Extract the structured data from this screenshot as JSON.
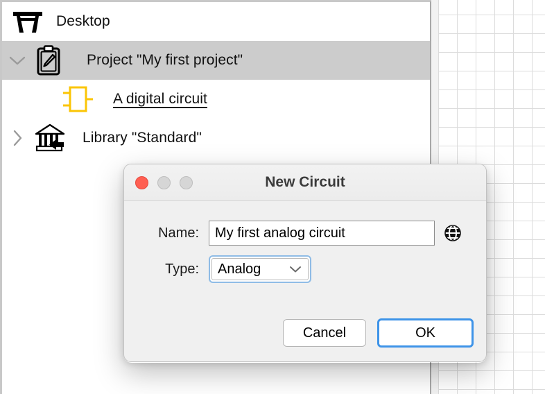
{
  "canvas": {
    "name": "circuit-canvas",
    "grid_color": "#dcdcdc",
    "background": "#ffffff"
  },
  "tree": {
    "selection_color": "#cccccc",
    "rows": [
      {
        "id": "desktop",
        "label": "Desktop",
        "icon": "desk-icon",
        "twisty": "none",
        "selected": false,
        "underlined": false
      },
      {
        "id": "project",
        "label": "Project \"My first project\"",
        "icon": "clipboard-pencil-icon",
        "twisty": "chevron-down-icon",
        "selected": true,
        "underlined": false
      },
      {
        "id": "circuit",
        "label": "A digital circuit",
        "icon": "digital-circuit-icon",
        "twisty": "none",
        "selected": false,
        "underlined": true,
        "icon_color": "#fbc505"
      },
      {
        "id": "library",
        "label": "Library \"Standard\"",
        "icon": "library-import-icon",
        "twisty": "chevron-right-icon",
        "selected": false,
        "underlined": false
      }
    ]
  },
  "dialog": {
    "title": "New Circuit",
    "window_controls": {
      "close": "close-button",
      "minimize": "minimize-button",
      "zoom": "zoom-button",
      "close_color": "#ff5f52",
      "inactive_color": "#d6d6d6"
    },
    "fields": {
      "name": {
        "label": "Name:",
        "value": "My first analog circuit",
        "placeholder": "",
        "trailing_icon": "globe-icon"
      },
      "type": {
        "label": "Type:",
        "value": "Analog",
        "options": [
          "Analog"
        ],
        "focus_color": "#8fbce6"
      }
    },
    "buttons": {
      "cancel": "Cancel",
      "ok": "OK",
      "ok_focus_color": "#3d93e8"
    }
  }
}
